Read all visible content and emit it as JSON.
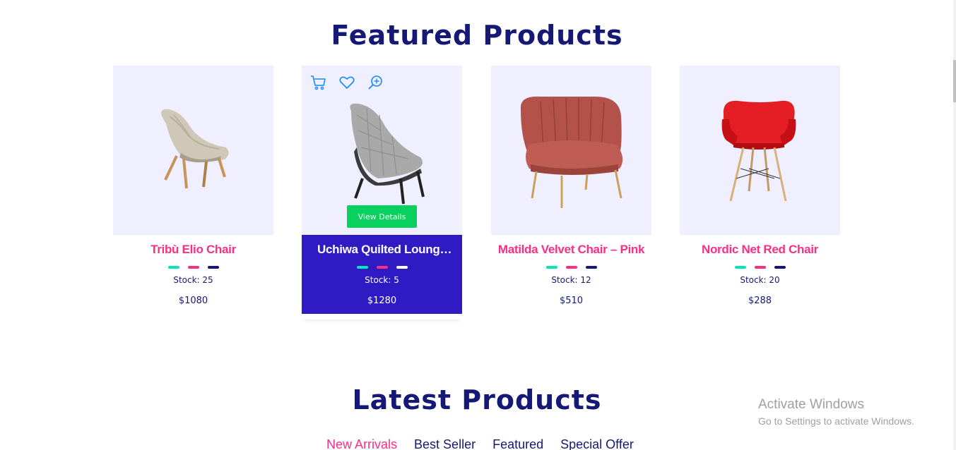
{
  "featured": {
    "title": "Featured Products",
    "products": [
      {
        "name": "Tribù Elio Chair",
        "stock": "Stock: 25",
        "price": "$1080"
      },
      {
        "name": "Uchiwa Quilted Lounge Chair",
        "stock": "Stock: 5",
        "price": "$1280",
        "view_details": "View Details"
      },
      {
        "name": "Matilda Velvet Chair – Pink",
        "stock": "Stock: 12",
        "price": "$510"
      },
      {
        "name": "Nordic Net Red Chair",
        "stock": "Stock: 20",
        "price": "$288"
      }
    ],
    "dot_colors": [
      "#05e6b7",
      "#fb2e86",
      "#151875"
    ],
    "active_dot_colors": [
      "#05e6b7",
      "#fb2e86",
      "#ffffff"
    ],
    "hover_icons": [
      "cart-icon",
      "heart-icon",
      "zoom-in-icon"
    ]
  },
  "latest": {
    "title": "Latest Products",
    "tabs": [
      "New Arrivals",
      "Best Seller",
      "Featured",
      "Special Offer"
    ]
  },
  "watermark": {
    "line1": "Activate Windows",
    "line2": "Go to Settings to activate Windows."
  },
  "colors": {
    "title": "#151875",
    "product_name": "#fb2e86",
    "active_card_bg": "#2f1ac4",
    "image_bg": "#f0efff",
    "button": "#08d15f"
  }
}
